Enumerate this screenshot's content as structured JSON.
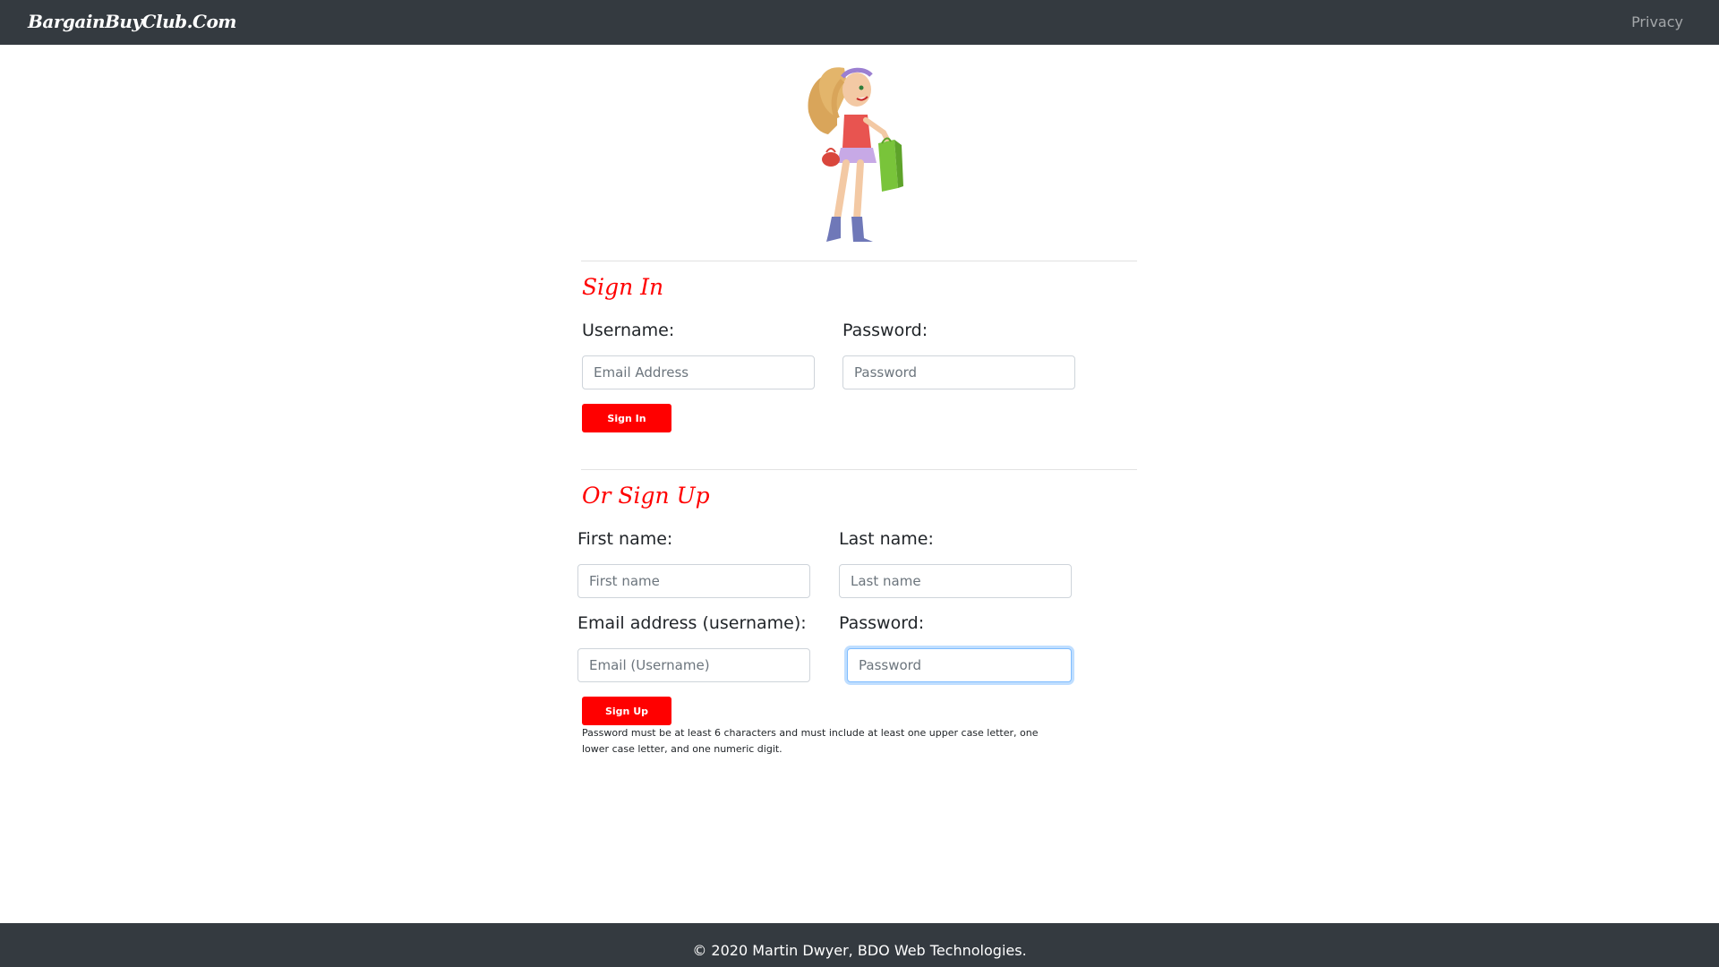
{
  "navbar": {
    "brand": "BargainBuyClub.Com",
    "privacy_link": "Privacy"
  },
  "mascot": {
    "icon": "shopping-girl-illustration"
  },
  "sign_in": {
    "title": "Sign In",
    "username_label": "Username:",
    "username_placeholder": "Email Address",
    "password_label": "Password:",
    "password_placeholder": "Password",
    "button_label": "Sign In"
  },
  "sign_up": {
    "title": "Or Sign Up",
    "first_name_label": "First name:",
    "first_name_placeholder": "First name",
    "last_name_label": "Last name:",
    "last_name_placeholder": "Last name",
    "email_label": "Email address (username):",
    "email_placeholder": "Email (Username)",
    "password_label": "Password:",
    "password_placeholder": "Password",
    "button_label": "Sign Up",
    "help_text": "Password must be at least 6 characters and must include at least one upper case letter, one lower case letter, and one numeric digit."
  },
  "footer": {
    "text": "© 2020 Martin Dwyer, BDO Web Technologies."
  },
  "colors": {
    "navbar_bg": "#343a40",
    "accent_red": "#ff0000",
    "focus_blue": "#80bdff"
  }
}
